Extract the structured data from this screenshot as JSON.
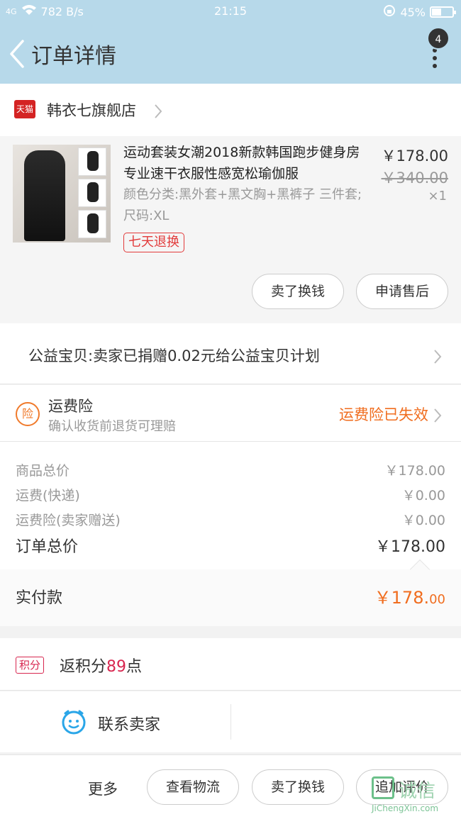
{
  "status_bar": {
    "network": "4G",
    "speed": "782 B/s",
    "time": "21:15",
    "battery": "45%",
    "battery_level": 0.45
  },
  "header": {
    "title": "订单详情",
    "badge_count": "4"
  },
  "shop": {
    "badge": "天猫",
    "name": "韩衣七旗舰店"
  },
  "item": {
    "title": "运动套装女潮2018新款韩国跑步健身房专业速干衣服性感宽松瑜伽服",
    "sku": "颜色分类:黑外套+黑文胸+黑裤子 三件套;尺码:XL",
    "tag": "七天退换",
    "price": "￥178.00",
    "original_price": "￥340.00",
    "quantity": "×1",
    "thumb_labels": [
      "黑色外套",
      "黑色文胸",
      "黑色长裤"
    ],
    "actions": {
      "sell": "卖了换钱",
      "after_sale": "申请售后"
    }
  },
  "charity": {
    "text": "公益宝贝:卖家已捐赠0.02元给公益宝贝计划"
  },
  "insurance": {
    "icon_text": "险",
    "title": "运费险",
    "subtitle": "确认收货前退货可理赔",
    "status": "运费险已失效"
  },
  "summary": {
    "rows": [
      {
        "label": "商品总价",
        "value": "￥178.00"
      },
      {
        "label": "运费(快递)",
        "value": "￥0.00"
      },
      {
        "label": "运费险(卖家赠送)",
        "value": "￥0.00"
      }
    ],
    "total_label": "订单总价",
    "total_value": "￥178.00",
    "paid_label": "实付款",
    "paid_value_int": "￥178.",
    "paid_value_dec": "00"
  },
  "points": {
    "tag": "积分",
    "prefix": "返积分",
    "value": "89",
    "suffix": "点"
  },
  "contact": {
    "label": "联系卖家"
  },
  "bottom_bar": {
    "more": "更多",
    "logistics": "查看物流",
    "sell": "卖了换钱",
    "review": "追加评价"
  },
  "watermark": {
    "text": "诚信",
    "url": "JiChengXin.com"
  },
  "colors": {
    "header_bg": "#b7d9ea",
    "accent_orange": "#f06d1f",
    "tmall_red": "#d42323",
    "points_red": "#d8264f"
  }
}
